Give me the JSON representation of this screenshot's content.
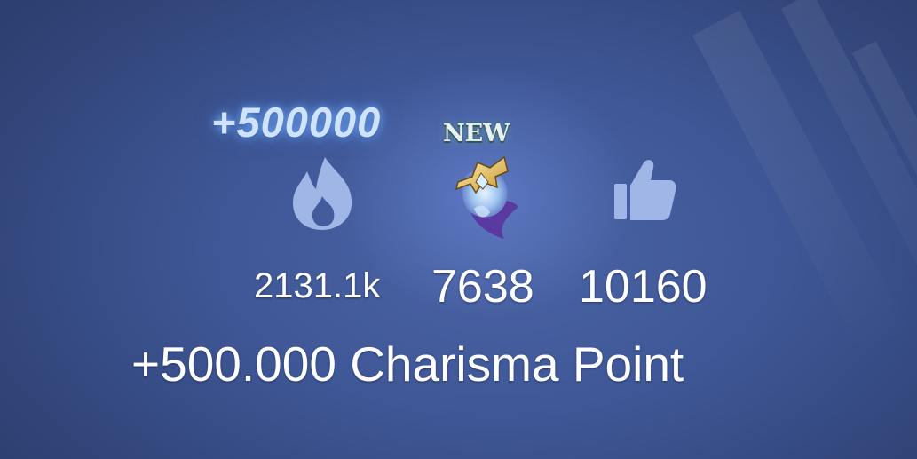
{
  "reward": {
    "bonus_amount": "+500000",
    "new_badge": "NEW"
  },
  "stats": {
    "popularity": "2131.1k",
    "charisma": "7638",
    "likes": "10160"
  },
  "icons": {
    "popularity": "fire-icon",
    "charisma": "charisma-emblem-icon",
    "likes": "thumbs-up-icon"
  },
  "caption": "+500.000 Charisma Point",
  "colors": {
    "background": "#3f5796",
    "icon_fill": "#9fb6e6",
    "bonus_glow": "#cfe3ff"
  }
}
